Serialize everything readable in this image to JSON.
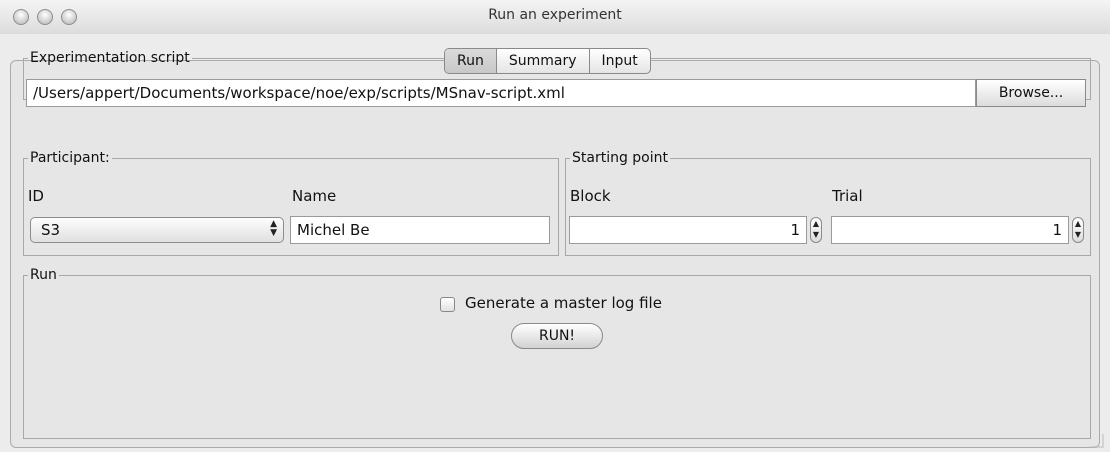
{
  "window": {
    "title": "Run an experiment"
  },
  "tabs": [
    {
      "label": "Run",
      "active": true
    },
    {
      "label": "Summary",
      "active": false
    },
    {
      "label": "Input",
      "active": false
    }
  ],
  "script_section": {
    "legend": "Experimentation script",
    "path": "/Users/appert/Documents/workspace/noe/exp/scripts/MSnav-script.xml",
    "browse_label": "Browse..."
  },
  "participant": {
    "legend": "Participant:",
    "id_label": "ID",
    "name_label": "Name",
    "id_value": "S3",
    "name_value": "Michel Be"
  },
  "starting_point": {
    "legend": "Starting point",
    "block_label": "Block",
    "trial_label": "Trial",
    "block_value": "1",
    "trial_value": "1"
  },
  "run_section": {
    "legend": "Run",
    "checkbox_label": "Generate a master log file",
    "checkbox_checked": false,
    "run_button_label": "RUN!"
  },
  "icons": {
    "select_arrows": "chevron-updown-icon",
    "stepper": "stepper-icon",
    "window_controls": "window-control-icon"
  }
}
